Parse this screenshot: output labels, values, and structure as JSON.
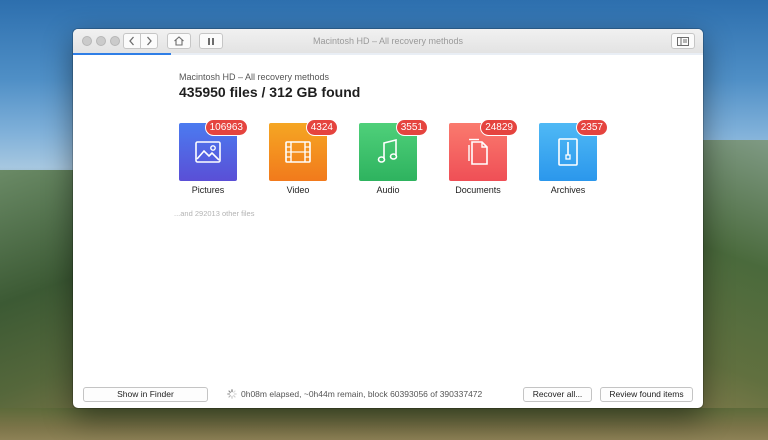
{
  "window": {
    "title": "Macintosh HD – All recovery methods",
    "progress_fraction": 0.155
  },
  "toolbar": {
    "back_icon": "chevron-left-icon",
    "forward_icon": "chevron-right-icon",
    "home_icon": "home-icon",
    "pause_icon": "pause-icon",
    "sidebar_icon": "sidebar-icon"
  },
  "header": {
    "subtitle": "Macintosh HD – All recovery methods",
    "title": "435950 files / 312 GB found"
  },
  "categories": [
    {
      "label": "Pictures",
      "count": "106963",
      "icon": "picture-icon",
      "color_top": "#4b7bf0",
      "color_bottom": "#5a4fd6"
    },
    {
      "label": "Video",
      "count": "4324",
      "icon": "film-icon",
      "color_top": "#f5a623",
      "color_bottom": "#f27a1c"
    },
    {
      "label": "Audio",
      "count": "3551",
      "icon": "music-note-icon",
      "color_top": "#4fd07a",
      "color_bottom": "#2eb35f"
    },
    {
      "label": "Documents",
      "count": "24829",
      "icon": "documents-icon",
      "color_top": "#fa7a6e",
      "color_bottom": "#ef4f56"
    },
    {
      "label": "Archives",
      "count": "2357",
      "icon": "archive-icon",
      "color_top": "#4fb9f5",
      "color_bottom": "#2b97ec"
    }
  ],
  "other_files": "...and 292013 other files",
  "footer": {
    "show_in_finder": "Show in Finder",
    "status": "0h08m elapsed, ~0h44m remain, block 60393056 of 390337472",
    "recover_all": "Recover all...",
    "review_found_items": "Review found items"
  },
  "colors": {
    "accent": "#2f7ee6",
    "badge": "#e5443f"
  }
}
